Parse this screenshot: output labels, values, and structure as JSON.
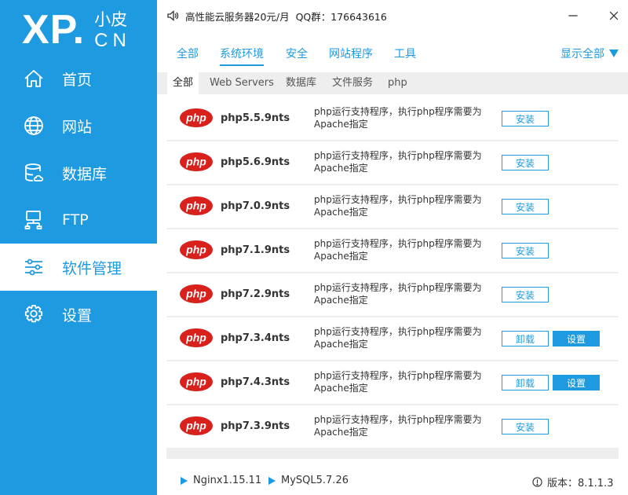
{
  "logo": {
    "main": "XP.",
    "cn_top": "小皮",
    "cn_bottom": "CN"
  },
  "sidebar": {
    "items": [
      {
        "label": "首页",
        "icon": "home-icon",
        "active": false
      },
      {
        "label": "网站",
        "icon": "globe-icon",
        "active": false
      },
      {
        "label": "数据库",
        "icon": "database-icon",
        "active": false
      },
      {
        "label": "FTP",
        "icon": "ftp-icon",
        "active": false
      },
      {
        "label": "软件管理",
        "icon": "sliders-icon",
        "active": true
      },
      {
        "label": "设置",
        "icon": "gear-icon",
        "active": false
      }
    ]
  },
  "topbar": {
    "notice": "高性能云服务器20元/月  QQ群：176643616",
    "icon": "speaker-icon"
  },
  "window": {
    "minimize_icon": "minimize-icon",
    "close_icon": "close-icon"
  },
  "tabs_primary": {
    "items": [
      "全部",
      "系统环境",
      "安全",
      "网站程序",
      "工具"
    ],
    "active": "系统环境",
    "show_all": "显示全部"
  },
  "tabs_secondary": {
    "items": [
      "全部",
      "Web Servers",
      "数据库",
      "文件服务",
      "php"
    ],
    "active": "全部"
  },
  "packages": {
    "logo_text": "php",
    "items": [
      {
        "name": "php5.5.9nts",
        "desc": "php运行支持程序，执行php程序需要为Apache指定",
        "buttons": [
          "安装"
        ]
      },
      {
        "name": "php5.6.9nts",
        "desc": "php运行支持程序，执行php程序需要为Apache指定",
        "buttons": [
          "安装"
        ]
      },
      {
        "name": "php7.0.9nts",
        "desc": "php运行支持程序，执行php程序需要为Apache指定",
        "buttons": [
          "安装"
        ]
      },
      {
        "name": "php7.1.9nts",
        "desc": "php运行支持程序，执行php程序需要为Apache指定",
        "buttons": [
          "安装"
        ]
      },
      {
        "name": "php7.2.9nts",
        "desc": "php运行支持程序，执行php程序需要为Apache指定",
        "buttons": [
          "安装"
        ]
      },
      {
        "name": "php7.3.4nts",
        "desc": "php运行支持程序，执行php程序需要为Apache指定",
        "buttons": [
          "卸载",
          "设置"
        ]
      },
      {
        "name": "php7.4.3nts",
        "desc": "php运行支持程序，执行php程序需要为Apache指定",
        "buttons": [
          "卸载",
          "设置"
        ]
      },
      {
        "name": "php7.3.9nts",
        "desc": "php运行支持程序，执行php程序需要为Apache指定",
        "buttons": [
          "安装"
        ]
      }
    ]
  },
  "footer": {
    "services": [
      "Nginx1.15.11",
      "MySQL5.7.26"
    ],
    "version": "版本：8.1.1.3"
  },
  "colors": {
    "accent": "#1e9ae0",
    "php_red": "#d8201c",
    "panel_gray": "#eeeeee"
  }
}
